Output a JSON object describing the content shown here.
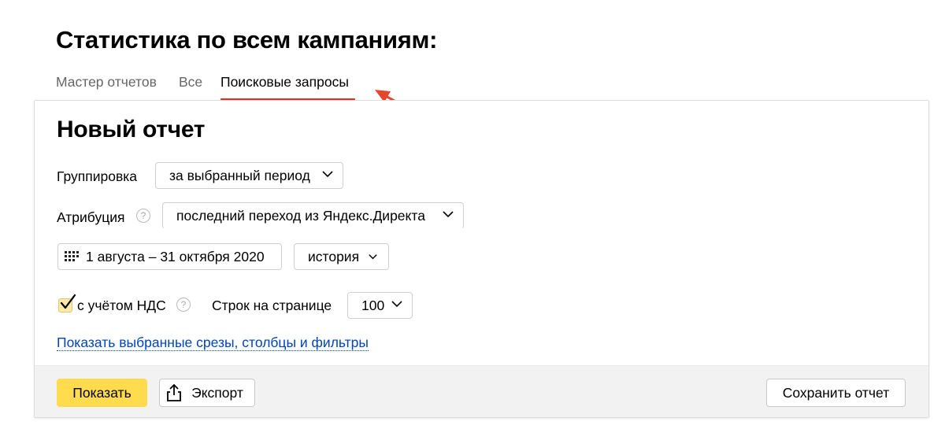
{
  "page": {
    "title": "Статистика по всем кампаниям:"
  },
  "tabs": [
    {
      "label": "Мастер отчетов",
      "active": false
    },
    {
      "label": "Все",
      "active": false
    },
    {
      "label": "Поисковые запросы",
      "active": true
    }
  ],
  "report": {
    "title": "Новый отчет",
    "grouping": {
      "label": "Группировка",
      "value": "за выбранный период"
    },
    "attribution": {
      "label": "Атрибуция",
      "value": "последний переход из Яндекс.Директа",
      "help_icon": "question-circle-icon"
    },
    "date_range": {
      "value": "1 августа – 31 октября 2020",
      "icon": "calendar-grid-icon"
    },
    "period_preset": {
      "value": "история"
    },
    "vat": {
      "label": "с учётом НДС",
      "checked": true,
      "help_icon": "question-circle-icon"
    },
    "rows_per_page": {
      "label": "Строк на странице",
      "value": "100"
    },
    "show_filters_link": "Показать выбранные срезы, столбцы и фильтры"
  },
  "footer": {
    "show_button": "Показать",
    "export_button": "Экспорт",
    "export_icon": "share-upload-icon",
    "save_button": "Сохранить отчет"
  },
  "colors": {
    "accent_tab_underline": "#f1271a",
    "primary_button": "#ffdb4d",
    "link": "#0044bb",
    "annotation_arrow": "#e8462b"
  }
}
